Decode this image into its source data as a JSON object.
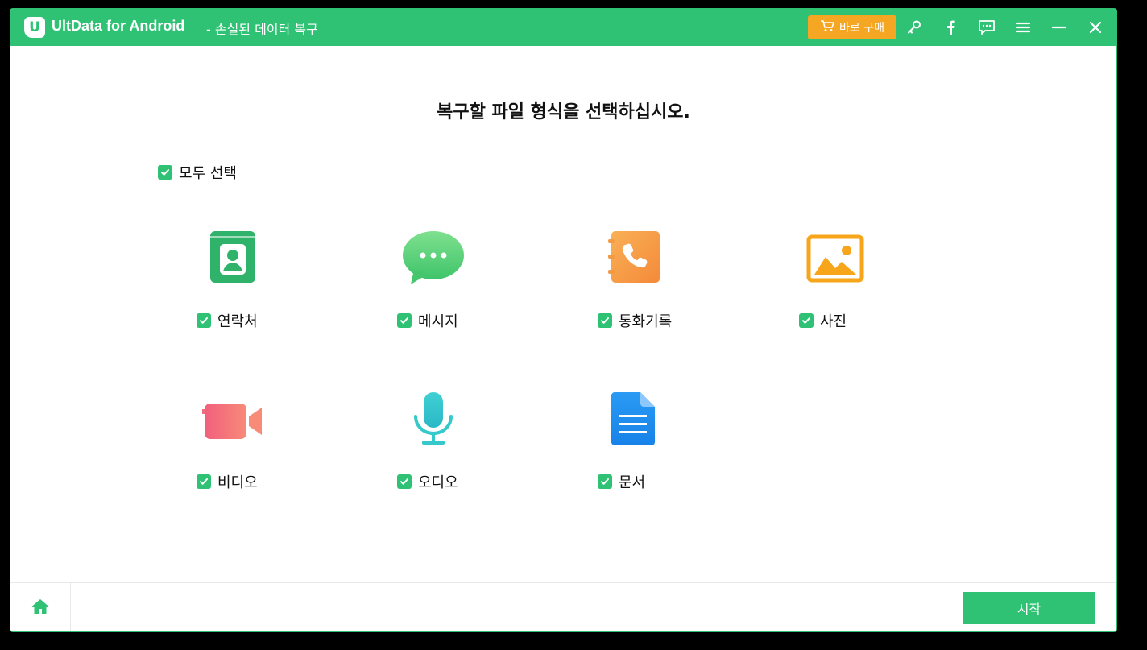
{
  "titlebar": {
    "logo_letter": "U",
    "app_name": "UltData for Android",
    "subtitle": "- 손실된 데이터 복구",
    "buy_label": "바로 구매",
    "icons": [
      "key-icon",
      "facebook-icon",
      "feedback-icon",
      "menu-icon",
      "minimize-icon",
      "close-icon"
    ]
  },
  "main": {
    "heading": "복구할 파일 형식을 선택하십시오.",
    "select_all_label": "모두 선택",
    "select_all_checked": true,
    "file_types": [
      {
        "label": "연락처",
        "icon": "contacts-icon",
        "checked": true,
        "color": "#2fb36b"
      },
      {
        "label": "메시지",
        "icon": "messages-icon",
        "checked": true,
        "color": "#5fd37a"
      },
      {
        "label": "통화기록",
        "icon": "call-log-icon",
        "checked": true,
        "color": "#f6a046"
      },
      {
        "label": "사진",
        "icon": "photos-icon",
        "checked": true,
        "color": "#f7a51a"
      },
      {
        "label": "비디오",
        "icon": "video-icon",
        "checked": true,
        "color": "#f06c7a"
      },
      {
        "label": "오디오",
        "icon": "audio-icon",
        "checked": true,
        "color": "#35c9cc"
      },
      {
        "label": "문서",
        "icon": "document-icon",
        "checked": true,
        "color": "#1e8ff0"
      }
    ]
  },
  "footer": {
    "home_icon": "home-icon",
    "start_label": "시작"
  },
  "colors": {
    "accent": "#2fc174",
    "buy": "#f5a623"
  }
}
